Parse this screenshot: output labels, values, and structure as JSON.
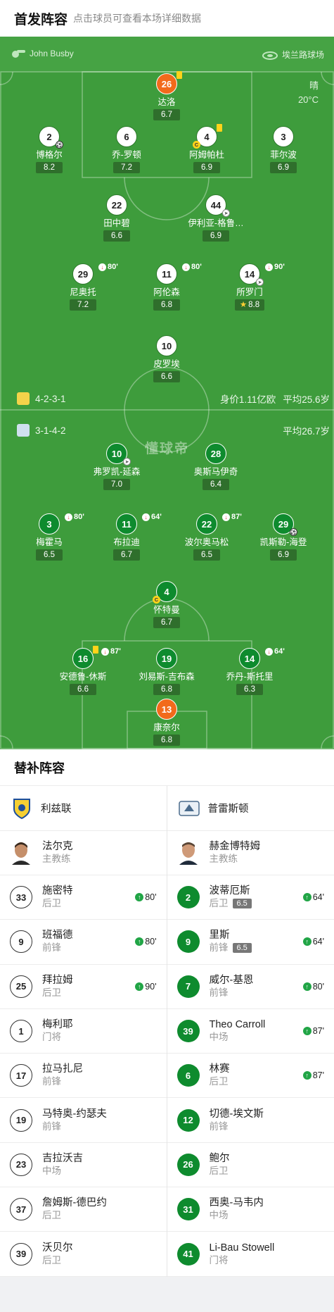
{
  "header": {
    "title": "首发阵容",
    "subtitle": "点击球员可查看本场详细数据"
  },
  "match": {
    "referee": "John Busby",
    "stadium": "埃兰路球场",
    "weather": "晴",
    "temp": "20°C"
  },
  "leeds": {
    "formation": "4-2-3-1",
    "value": "身价1.11亿欧",
    "avg_age": "平均25.6岁"
  },
  "preston": {
    "formation": "3-1-4-2",
    "avg_age": "平均26.7岁"
  },
  "watermark": "懂球帝",
  "players": {
    "leeds": [
      {
        "num": "26",
        "name": "达洛",
        "rating": "6.7"
      },
      {
        "num": "2",
        "name": "博格尔",
        "rating": "8.2"
      },
      {
        "num": "6",
        "name": "乔-罗顿",
        "rating": "7.2"
      },
      {
        "num": "4",
        "name": "阿姆帕杜",
        "rating": "6.9"
      },
      {
        "num": "3",
        "name": "菲尔波",
        "rating": "6.9"
      },
      {
        "num": "22",
        "name": "田中碧",
        "rating": "6.6"
      },
      {
        "num": "44",
        "name": "伊利亚-格鲁…",
        "rating": "6.9"
      },
      {
        "num": "29",
        "name": "尼奥托",
        "rating": "7.2",
        "sub_min": "80'"
      },
      {
        "num": "11",
        "name": "阿伦森",
        "rating": "6.8",
        "sub_min": "80'"
      },
      {
        "num": "14",
        "name": "所罗门",
        "rating": "8.8",
        "sub_min": "90'"
      },
      {
        "num": "10",
        "name": "皮罗埃",
        "rating": "6.6"
      }
    ],
    "preston": [
      {
        "num": "10",
        "name": "弗罗凯-延森",
        "rating": "7.0"
      },
      {
        "num": "28",
        "name": "奥斯马伊奇",
        "rating": "6.4"
      },
      {
        "num": "3",
        "name": "梅霍马",
        "rating": "6.5",
        "sub_min": "80'"
      },
      {
        "num": "11",
        "name": "布拉迪",
        "rating": "6.7",
        "sub_min": "64'"
      },
      {
        "num": "22",
        "name": "波尔奥马松",
        "rating": "6.5",
        "sub_min": "87'"
      },
      {
        "num": "29",
        "name": "凯斯勒-海登",
        "rating": "6.9"
      },
      {
        "num": "4",
        "name": "怀特曼",
        "rating": "6.7"
      },
      {
        "num": "16",
        "name": "安德鲁-休斯",
        "rating": "6.6",
        "sub_min": "87'"
      },
      {
        "num": "19",
        "name": "刘易斯-吉布森",
        "rating": "6.8"
      },
      {
        "num": "14",
        "name": "乔丹-斯托里",
        "rating": "6.3",
        "sub_min": "64'"
      },
      {
        "num": "13",
        "name": "康奈尔",
        "rating": "6.8"
      }
    ]
  },
  "subs_title": "替补阵容",
  "subs": {
    "left": {
      "team": "利兹联",
      "coach": {
        "name": "法尔克",
        "role": "主教练"
      },
      "rows": [
        {
          "num": "33",
          "name": "施密特",
          "pos": "后卫",
          "in": "80'"
        },
        {
          "num": "9",
          "name": "班福德",
          "pos": "前锋",
          "in": "80'"
        },
        {
          "num": "25",
          "name": "拜拉姆",
          "pos": "后卫",
          "in": "90'"
        },
        {
          "num": "1",
          "name": "梅利耶",
          "pos": "门将"
        },
        {
          "num": "17",
          "name": "拉马扎尼",
          "pos": "前锋"
        },
        {
          "num": "19",
          "name": "马特奥-约瑟夫",
          "pos": "前锋"
        },
        {
          "num": "23",
          "name": "吉拉沃吉",
          "pos": "中场"
        },
        {
          "num": "37",
          "name": "詹姆斯-德巴约",
          "pos": "后卫"
        },
        {
          "num": "39",
          "name": "沃贝尔",
          "pos": "后卫"
        }
      ]
    },
    "right": {
      "team": "普雷斯顿",
      "coach": {
        "name": "赫金博特姆",
        "role": "主教练"
      },
      "rows": [
        {
          "num": "2",
          "name": "波蒂厄斯",
          "pos": "后卫",
          "rating": "6.5",
          "in": "64'"
        },
        {
          "num": "9",
          "name": "里斯",
          "pos": "前锋",
          "rating": "6.5",
          "in": "64'"
        },
        {
          "num": "7",
          "name": "威尔-基恩",
          "pos": "前锋",
          "in": "80'"
        },
        {
          "num": "39",
          "name": "Theo Carroll",
          "pos": "中场",
          "in": "87'"
        },
        {
          "num": "6",
          "name": "林赛",
          "pos": "后卫",
          "in": "87'"
        },
        {
          "num": "12",
          "name": "切德-埃文斯",
          "pos": "前锋"
        },
        {
          "num": "26",
          "name": "鲍尔",
          "pos": "后卫"
        },
        {
          "num": "31",
          "name": "西奥-马韦内",
          "pos": "中场"
        },
        {
          "num": "41",
          "name": "Li-Bau Stowell",
          "pos": "门将"
        }
      ]
    }
  }
}
